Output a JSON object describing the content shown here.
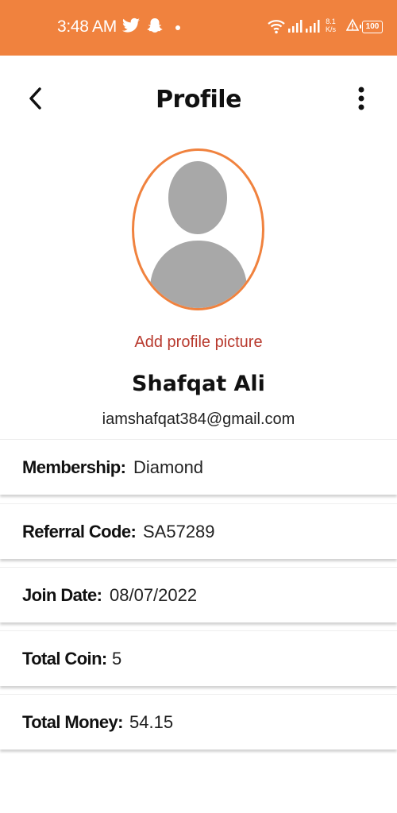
{
  "status_bar": {
    "time": "3:48 AM",
    "icons": [
      "twitter-icon",
      "snapchat-icon",
      "notification-dot",
      "wifi-icon",
      "signal-icon",
      "data-speed",
      "warning-icon",
      "battery-icon"
    ],
    "speed_value": "8.1",
    "speed_unit": "K/s",
    "battery": "100",
    "background_color": "#f0823e"
  },
  "app_bar": {
    "title": "Profile",
    "back_icon": "chevron-left-icon",
    "menu_icon": "more-vertical-icon"
  },
  "profile": {
    "avatar_icon": "person-placeholder-icon",
    "add_picture_label": "Add profile picture",
    "name": "Shafqat Ali",
    "email": "iamshafqat384@gmail.com",
    "accent_color": "#f0823e",
    "link_color": "#b83a2e"
  },
  "info": {
    "membership": {
      "label": "Membership:",
      "value": "Diamond"
    },
    "referral": {
      "label": "Referral Code:",
      "value": "SA57289"
    },
    "join_date": {
      "label": "Join Date:",
      "value": "08/07/2022"
    },
    "total_coin": {
      "label": "Total Coin:",
      "value": "5"
    },
    "total_money": {
      "label": "Total Money:",
      "value": "54.15"
    }
  }
}
